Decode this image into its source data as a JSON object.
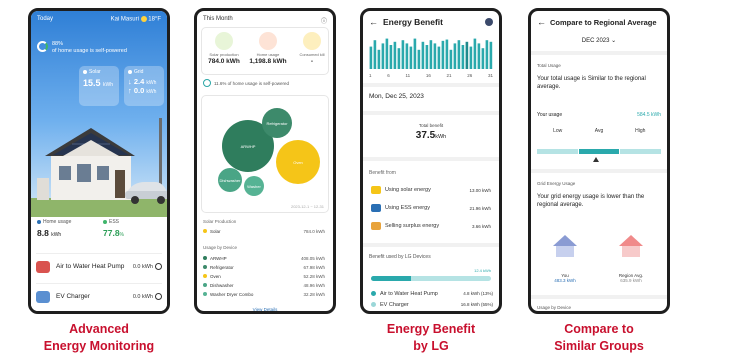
{
  "captions": [
    [
      "Advanced",
      "Energy Monitoring"
    ],
    [
      "Energy Benefit",
      "by LG"
    ],
    [
      "Compare to",
      "Similar Groups"
    ]
  ],
  "screen1": {
    "title": "Today",
    "weather": "Kai Masuri",
    "temp": "18°F",
    "self_pct": "88%",
    "self_line": "of home usage is self-powered",
    "solar_label": "Solar",
    "solar_value": "15.5",
    "solar_unit": "kWh",
    "grid_label": "Grid",
    "grid_in": "2.4",
    "grid_out": "0.0",
    "grid_unit": "kWh",
    "home_label": "Home usage",
    "home_value": "8.8",
    "home_unit": "kWh",
    "ess_label": "ESS",
    "ess_value": "77.8",
    "ess_unit": "%",
    "devices": [
      {
        "name": "Air to Water Heat Pump",
        "value": "0.0 kWh"
      },
      {
        "name": "EV Charger",
        "value": "0.0 kWh"
      }
    ]
  },
  "screen2": {
    "title": "This Month",
    "items": [
      {
        "label": "Solar production",
        "value": "784.0 kWh"
      },
      {
        "label": "Home usage",
        "value": "1,198.8 kWh"
      },
      {
        "label": "Consumed kill",
        "value": "-"
      }
    ],
    "self_text": "11.6% of home usage is self-powered",
    "bubbles": [
      "ARWHP",
      "Refrigerator",
      "Oven",
      "Dishwasher",
      "Washer"
    ],
    "date_note": "2023-12-1 ~ 12-31",
    "solar_section": "Solar Production",
    "solar_row": {
      "name": "Solar",
      "value": "784.0 kWh"
    },
    "usage_section": "Usage by Device",
    "usage_rows": [
      {
        "name": "ARWHP",
        "value": "408.05 kWh"
      },
      {
        "name": "Refrigerator",
        "value": "67.98 kWh"
      },
      {
        "name": "Oven",
        "value": "52.28 kWh"
      },
      {
        "name": "Dishwasher",
        "value": "48.96 kWh"
      },
      {
        "name": "Washer Dryer Combo",
        "value": "32.28 kWh"
      }
    ],
    "more": "View Details"
  },
  "screen3": {
    "title": "Energy Benefit",
    "axis": [
      "1",
      "6",
      "11",
      "16",
      "21",
      "26",
      "31"
    ],
    "date": "Mon, Dec 25, 2023",
    "total_label": "Total benefit",
    "total_value": "37.5",
    "total_unit": "kWh",
    "benefit_from": "Benefit from",
    "rows": [
      {
        "name": "Using solar energy",
        "value": "13.00 kWh"
      },
      {
        "name": "Using ESS energy",
        "value": "21.96 kWh"
      },
      {
        "name": "Selling surplus energy",
        "value": "3.66 kWh"
      }
    ],
    "lg_label": "Benefit used by LG Devices",
    "progress_label": "12.4 kWh",
    "progress": 0.33,
    "devices": [
      {
        "name": "Air to Water Heat Pump",
        "value": "4.8 kWh (13%)"
      },
      {
        "name": "EV Charger",
        "value": "16.8 kWh (55%)"
      }
    ]
  },
  "screen4": {
    "title": "Compare to Regional Average",
    "month": "DEC 2023",
    "total_label": "Total Usage",
    "total_text": "Your total usage is Similar to the regional average.",
    "your_usage": "Your usage",
    "your_value": "584.5 kWh",
    "levels": [
      "Low",
      "Avg",
      "High"
    ],
    "grid_label": "Grid Energy Usage",
    "grid_text": "Your grid energy usage is lower than the regional average.",
    "you_label": "You",
    "you_value": "483.3 kWh",
    "region_label": "Region Avg.",
    "region_value": "635.9 kWh",
    "device_label": "Usage by Device"
  },
  "colors": {
    "caption": "#c8102e",
    "teal": "#2aa9ac",
    "green": "#2f7d5d",
    "yellow": "#f5c518"
  }
}
